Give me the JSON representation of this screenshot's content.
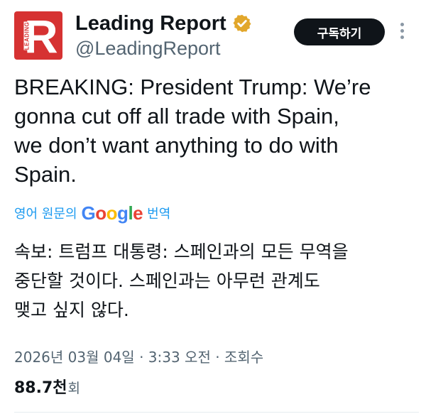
{
  "account": {
    "display_name": "Leading Report",
    "handle": "@LeadingReport",
    "avatar_letter": "R",
    "avatar_word": "LEADING",
    "brand_color": "#d63232",
    "verified_color": "#e2a72b"
  },
  "actions": {
    "subscribe_label": "구독하기",
    "more_icon": "more-vertical-icon"
  },
  "post": {
    "text": "BREAKING: President Trump: We’re\ngonna cut off all trade with Spain,\nwe don’t want anything to do with\nSpain.",
    "translate_prefix": "영어 원문의",
    "translate_brand": "Google",
    "translate_suffix": "번역",
    "translated_text": "속보: 트럼프 대통령: 스페인과의 모든 무역을\n중단할 것이다. 스페인과는 아무런 관계도\n맺고 싶지 않다.",
    "timestamp": "2026년 03월 04일 · 3:33 오전 · 조회수",
    "views_count": "88.7천",
    "views_label": "회"
  },
  "colors": {
    "link": "#1d9bf0",
    "secondary_text": "#536471",
    "button_bg": "#0f1419"
  }
}
